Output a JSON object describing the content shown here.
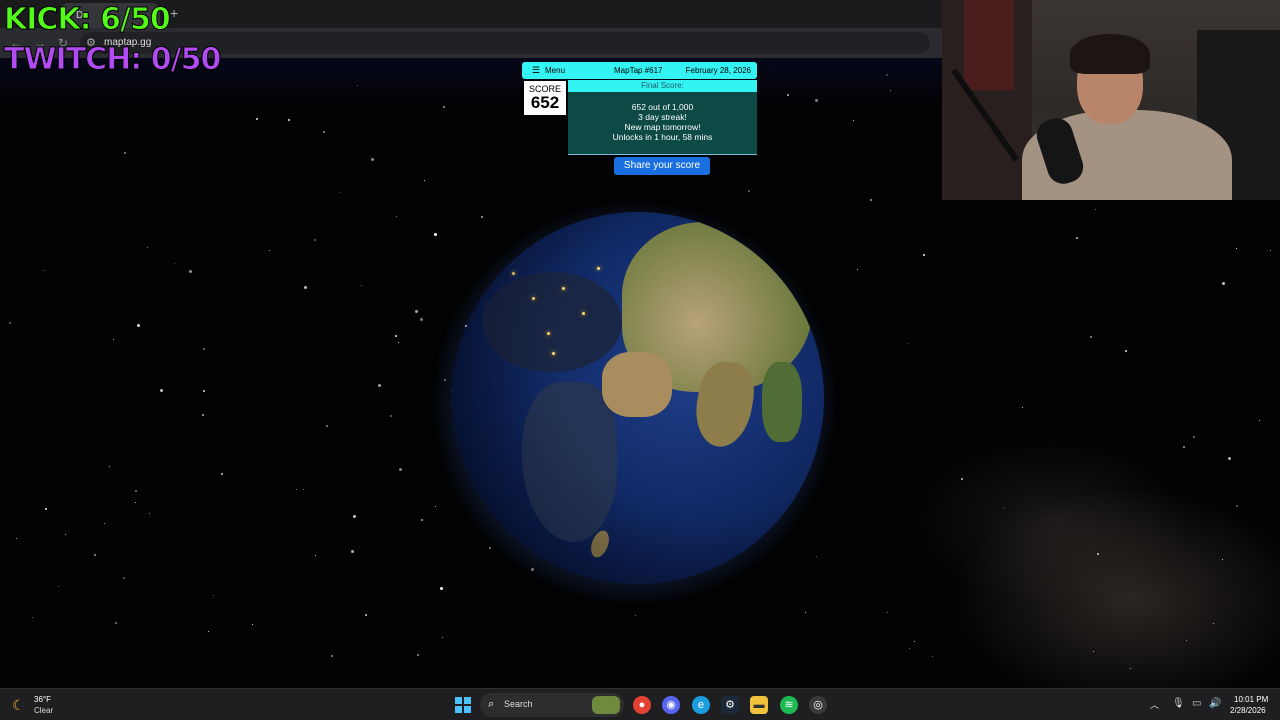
{
  "overlay": {
    "kick": "KICK: 6/50",
    "twitch": "TWITCH: 0/50"
  },
  "browser": {
    "tab_label": "D",
    "new_tab": "+",
    "url": "maptap.gg"
  },
  "maptap": {
    "menu_label": "Menu",
    "puzzle_title": "MapTap #617",
    "date": "February 28, 2026",
    "score_label": "SCORE",
    "score_value": "652",
    "final_score_label": "Final Score:",
    "result_lines": [
      "652 out of 1,000",
      "3 day streak!",
      "New map tomorrow!",
      "Unlocks in 1 hour, 58 mins"
    ],
    "share_button": "Share your score"
  },
  "taskbar": {
    "weather_temp": "36°F",
    "weather_condition": "Clear",
    "search_label": "Search",
    "clock_time": "10:01 PM",
    "clock_date": "2/28/2026",
    "apps": [
      "chrome-icon",
      "discord-icon",
      "edge-icon",
      "steam-icon",
      "file-explorer-icon",
      "spotify-icon",
      "obs-icon"
    ]
  },
  "colors": {
    "kick": "#53fc18",
    "twitch": "#b24bf3",
    "maptap_accent": "#33f3f3",
    "share_button": "#1a6fe0"
  }
}
